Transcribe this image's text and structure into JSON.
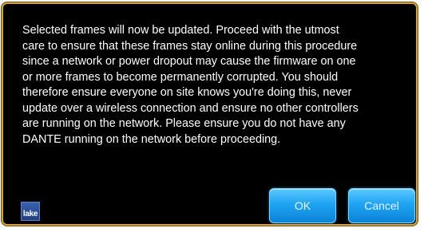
{
  "dialog": {
    "message": "Selected frames will now be updated. Proceed with the utmost\ncare to ensure that these frames stay online during this procedure\nsince a network or power dropout may cause the firmware on one\nor more frames to become permanently corrupted. You should\ntherefore ensure everyone on site knows you're doing this, never\nupdate over a wireless connection and ensure no other controllers\nare running on the network. Please ensure you do not have any\nDANTE running on the network before proceeding.",
    "logo_text": "lake",
    "ok_label": "OK",
    "cancel_label": "Cancel"
  },
  "colors": {
    "background": "#000000",
    "border": "#d2a23c",
    "text": "#ffffff",
    "button": "#1fa4f2",
    "logo": "#2d4f96"
  }
}
